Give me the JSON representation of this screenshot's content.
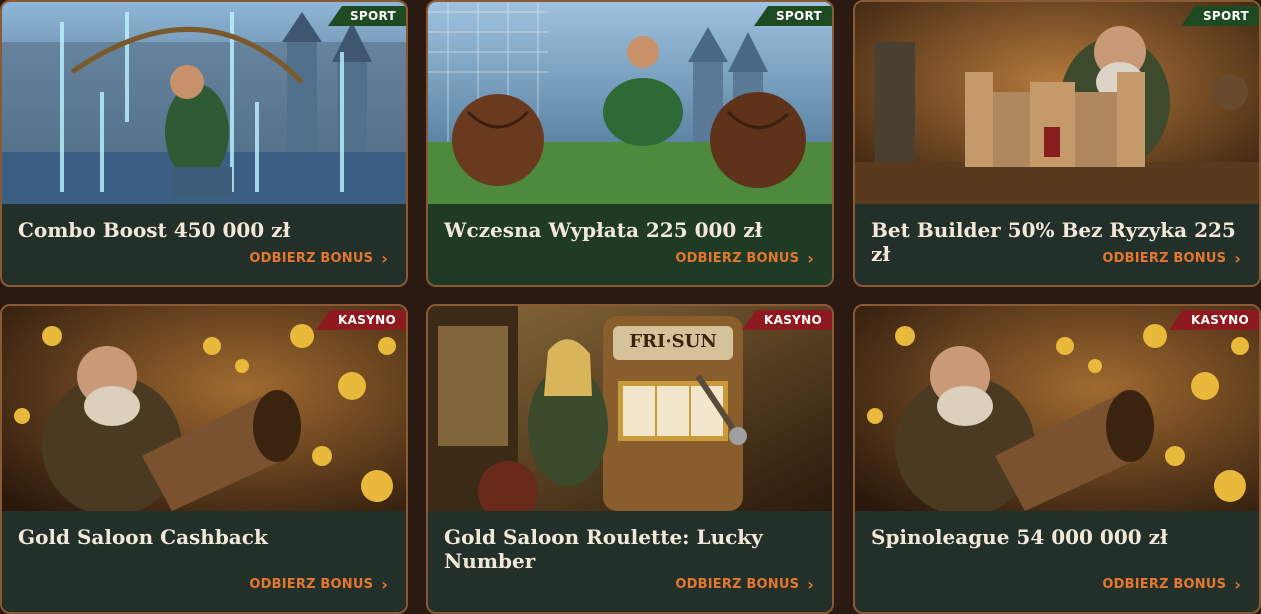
{
  "cards": [
    {
      "title": "Combo Boost 450 000 zł",
      "badge": "SPORT",
      "cta": "ODBIERZ BONUS",
      "art": "archer-illustration"
    },
    {
      "title": "Wczesna Wypłata 225 000 zł",
      "badge": "SPORT",
      "cta": "ODBIERZ BONUS",
      "art": "football-player-illustration"
    },
    {
      "title": "Bet Builder 50% Bez Ryzyka 225 zł",
      "badge": "SPORT",
      "cta": "ODBIERZ BONUS",
      "art": "castle-builder-illustration"
    },
    {
      "title": "Gold Saloon Cashback",
      "badge": "KASYNO",
      "cta": "ODBIERZ BONUS",
      "art": "coin-cannon-illustration"
    },
    {
      "title": "Gold Saloon Roulette: Lucky Number",
      "badge": "KASYNO",
      "cta": "ODBIERZ BONUS",
      "art": "slot-machine-illustration"
    },
    {
      "title": "Spinoleague 54 000 000 zł",
      "badge": "KASYNO",
      "cta": "ODBIERZ BONUS",
      "art": "coin-cannon-illustration"
    }
  ],
  "slot_sign": "FRI·SUN",
  "colors": {
    "sport_badge": "#1e4a22",
    "casino_badge": "#8d1a1e",
    "cta": "#e5772e",
    "card_border": "#8a5a34"
  }
}
